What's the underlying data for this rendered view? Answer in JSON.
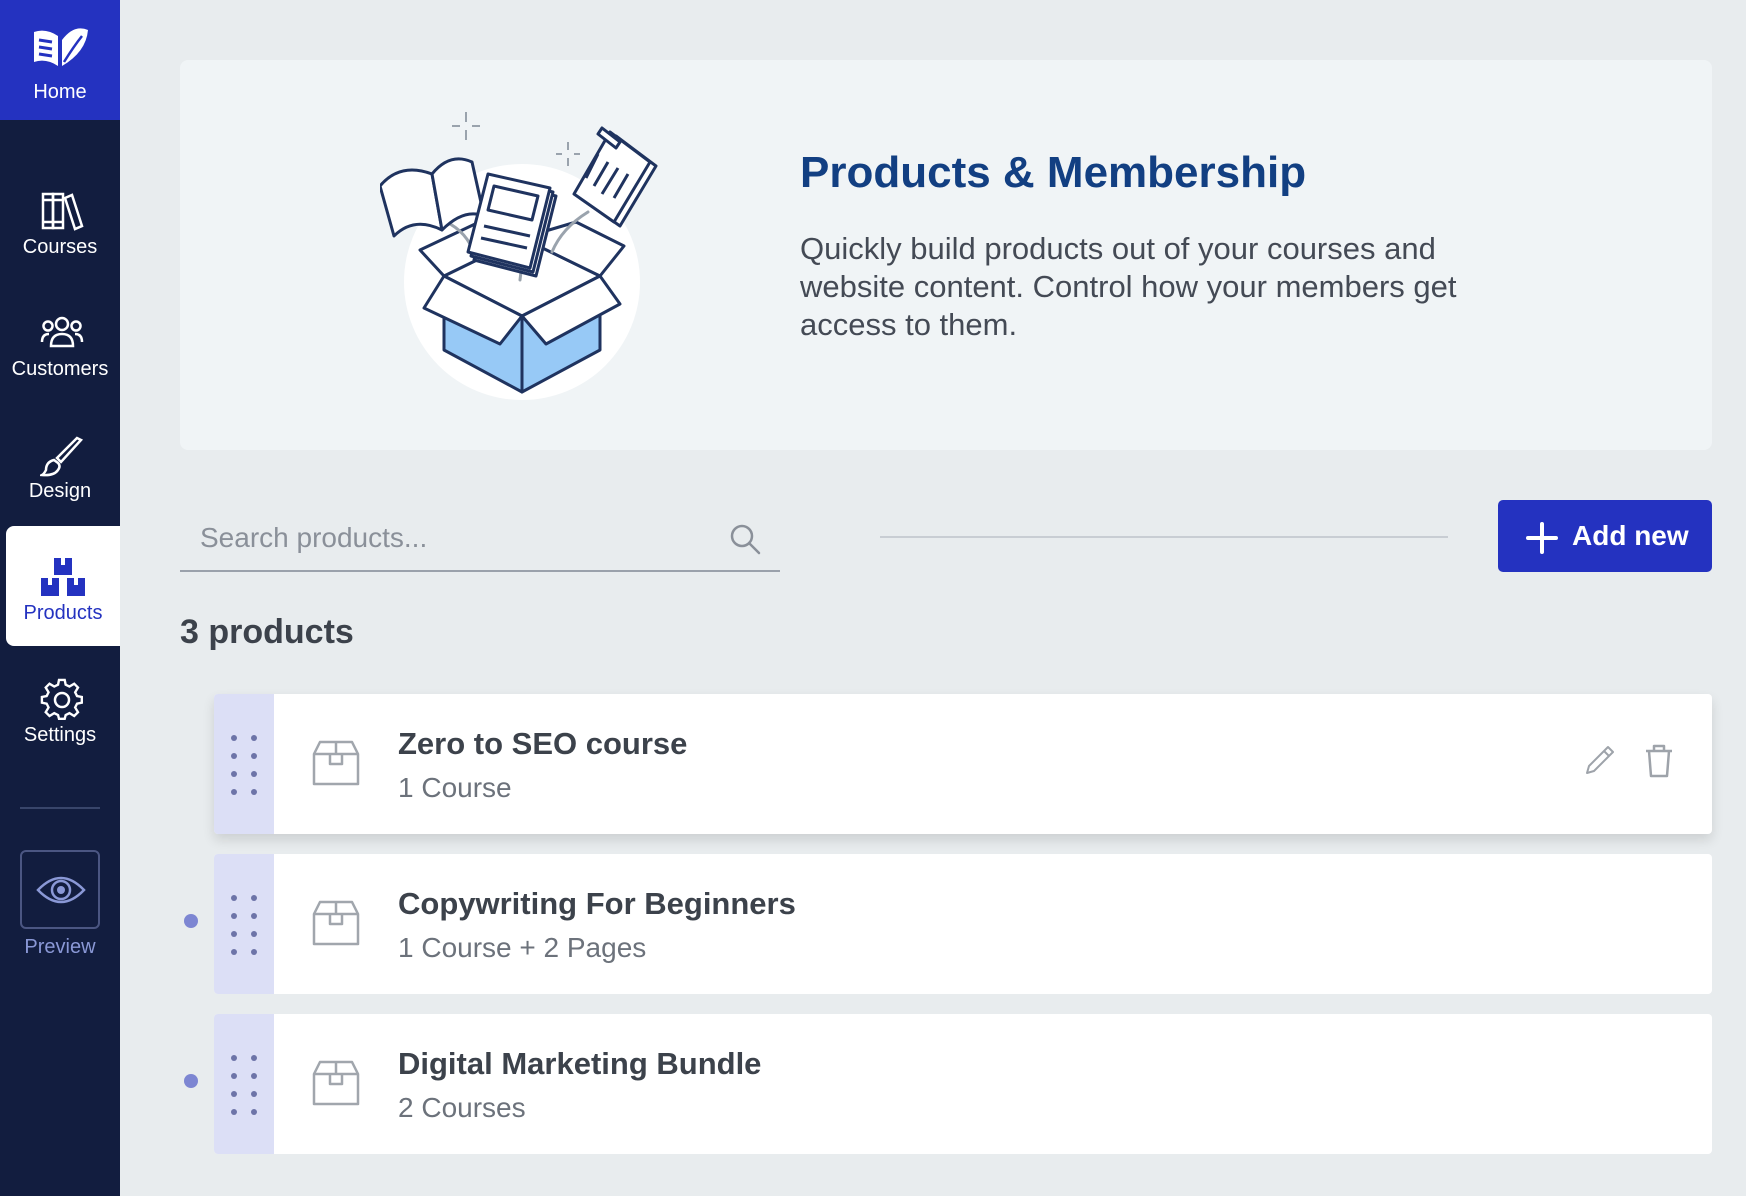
{
  "sidebar": {
    "home_label": "Home",
    "items": [
      {
        "label": "Courses"
      },
      {
        "label": "Customers"
      },
      {
        "label": "Design"
      },
      {
        "label": "Products"
      },
      {
        "label": "Settings"
      }
    ],
    "preview_label": "Preview"
  },
  "hero": {
    "title": "Products & Membership",
    "description": "Quickly build products out of your courses and website content. Control how your members get access to them."
  },
  "search": {
    "placeholder": "Search products...",
    "value": ""
  },
  "add_button": {
    "label": "Add new"
  },
  "product_count": "3 products",
  "products": [
    {
      "title": "Zero to SEO course",
      "subtitle": "1 Course"
    },
    {
      "title": "Copywriting For Beginners",
      "subtitle": "1 Course + 2 Pages"
    },
    {
      "title": "Digital Marketing Bundle",
      "subtitle": "2 Courses"
    }
  ],
  "colors": {
    "sidebar_bg": "#121d3f",
    "accent": "#2432c0",
    "title_blue": "#123f82",
    "drag_handle_bg": "#dcdff6"
  },
  "icons": {
    "home": "book-leaf-icon",
    "courses": "books-icon",
    "customers": "users-icon",
    "design": "brush-icon",
    "products": "boxes-icon",
    "settings": "gear-icon",
    "preview": "eye-icon",
    "search": "search-icon",
    "add": "plus-icon",
    "drag": "drag-handle-icon",
    "product": "package-icon",
    "edit": "pencil-icon",
    "delete": "trash-icon"
  }
}
